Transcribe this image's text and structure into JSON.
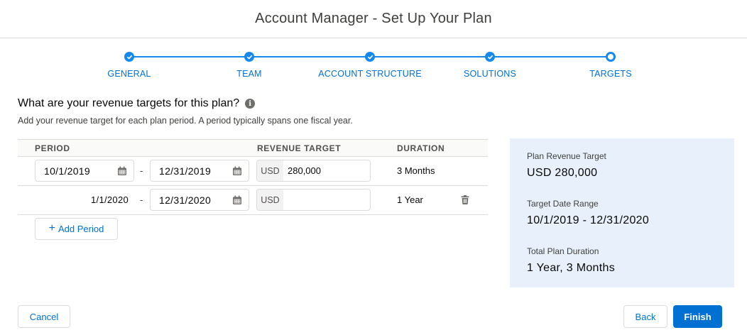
{
  "header": {
    "title": "Account Manager - Set Up Your Plan"
  },
  "steps": [
    {
      "label": "GENERAL",
      "state": "complete"
    },
    {
      "label": "TEAM",
      "state": "complete"
    },
    {
      "label": "ACCOUNT STRUCTURE",
      "state": "complete"
    },
    {
      "label": "SOLUTIONS",
      "state": "complete"
    },
    {
      "label": "TARGETS",
      "state": "current"
    }
  ],
  "main": {
    "question": "What are your revenue targets for this plan?",
    "subtext": "Add your revenue target for each plan period. A period typically spans one fiscal year.",
    "columns": {
      "period": "PERIOD",
      "revenue": "REVENUE TARGET",
      "duration": "DURATION"
    },
    "rows": [
      {
        "start": "10/1/2019",
        "end": "12/31/2019",
        "currency": "USD",
        "revenue": "280,000",
        "duration": "3 Months"
      },
      {
        "start": "1/1/2020",
        "end": "12/31/2020",
        "currency": "USD",
        "revenue": "",
        "duration": "1 Year"
      }
    ],
    "separator": "-",
    "add_period_label": "Add Period"
  },
  "summary": {
    "revenue_label": "Plan Revenue Target",
    "revenue_value": "USD 280,000",
    "range_label": "Target Date Range",
    "range_value": "10/1/2019 - 12/31/2020",
    "duration_label": "Total Plan Duration",
    "duration_value": "1 Year, 3 Months"
  },
  "footer": {
    "cancel_label": "Cancel",
    "back_label": "Back",
    "finish_label": "Finish"
  },
  "colors": {
    "brand": "#0070d2",
    "step": "#1589ee",
    "summary_bg": "#e8f1fb"
  }
}
